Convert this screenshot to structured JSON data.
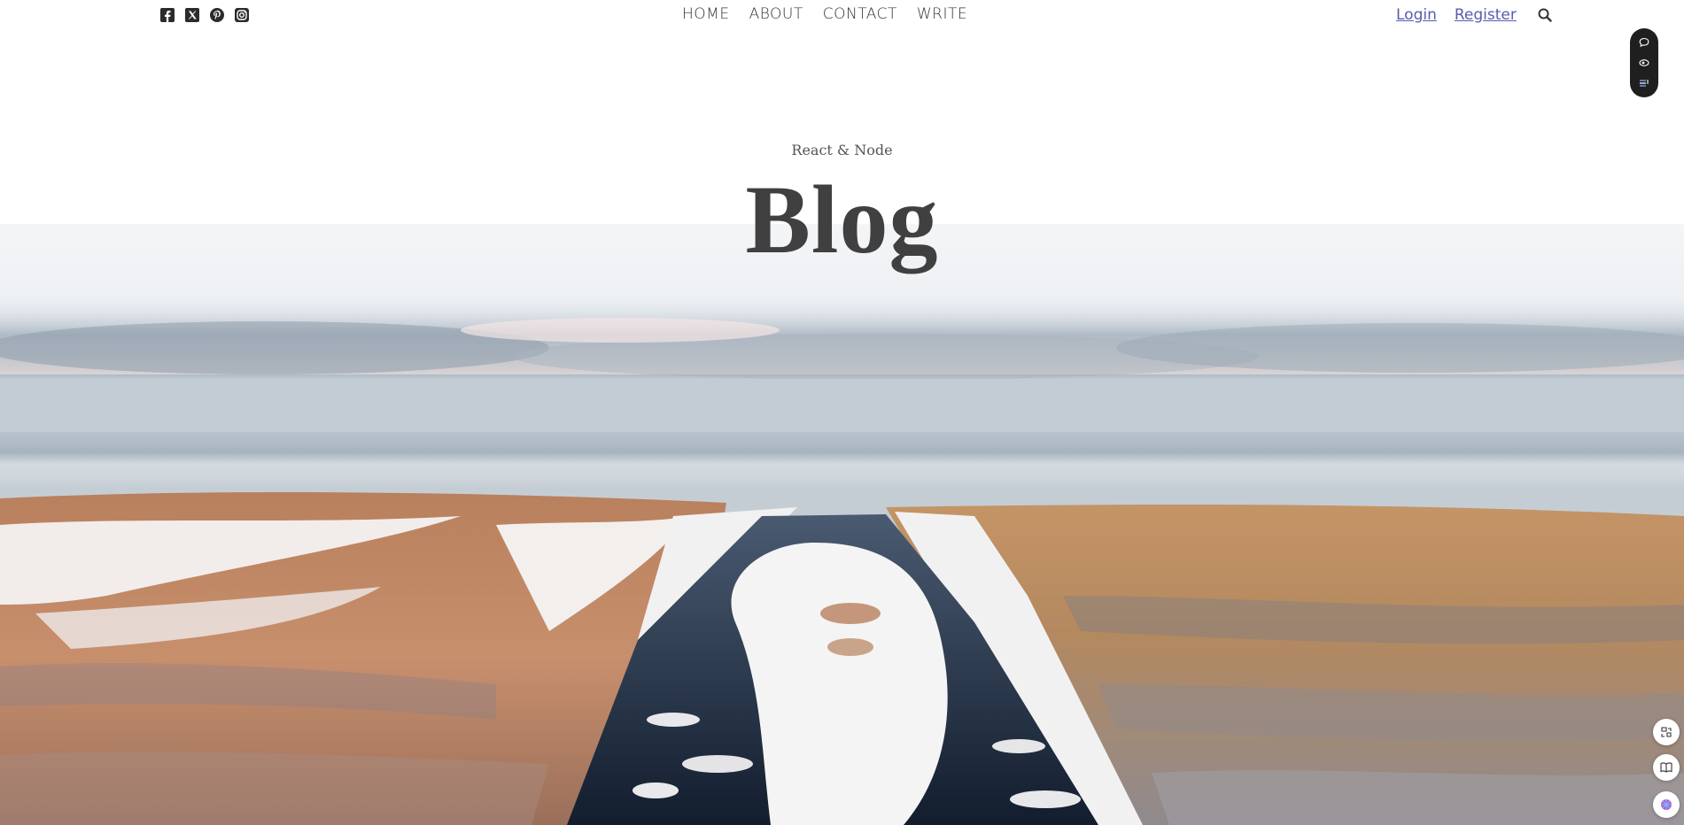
{
  "nav": {
    "social": [
      {
        "icon": "facebook-icon"
      },
      {
        "icon": "x-twitter-icon"
      },
      {
        "icon": "pinterest-icon"
      },
      {
        "icon": "instagram-icon"
      }
    ],
    "items": [
      {
        "label": "HOME"
      },
      {
        "label": "ABOUT"
      },
      {
        "label": "CONTACT"
      },
      {
        "label": "WRITE"
      }
    ],
    "login": "Login",
    "register": "Register",
    "search_icon": "search-icon"
  },
  "header": {
    "subtitle": "React & Node",
    "title": "Blog"
  },
  "colors": {
    "nav_text": "#333333",
    "link": "#5a5ab0",
    "title": "#404040",
    "pill_bg": "#1f1f1f"
  }
}
